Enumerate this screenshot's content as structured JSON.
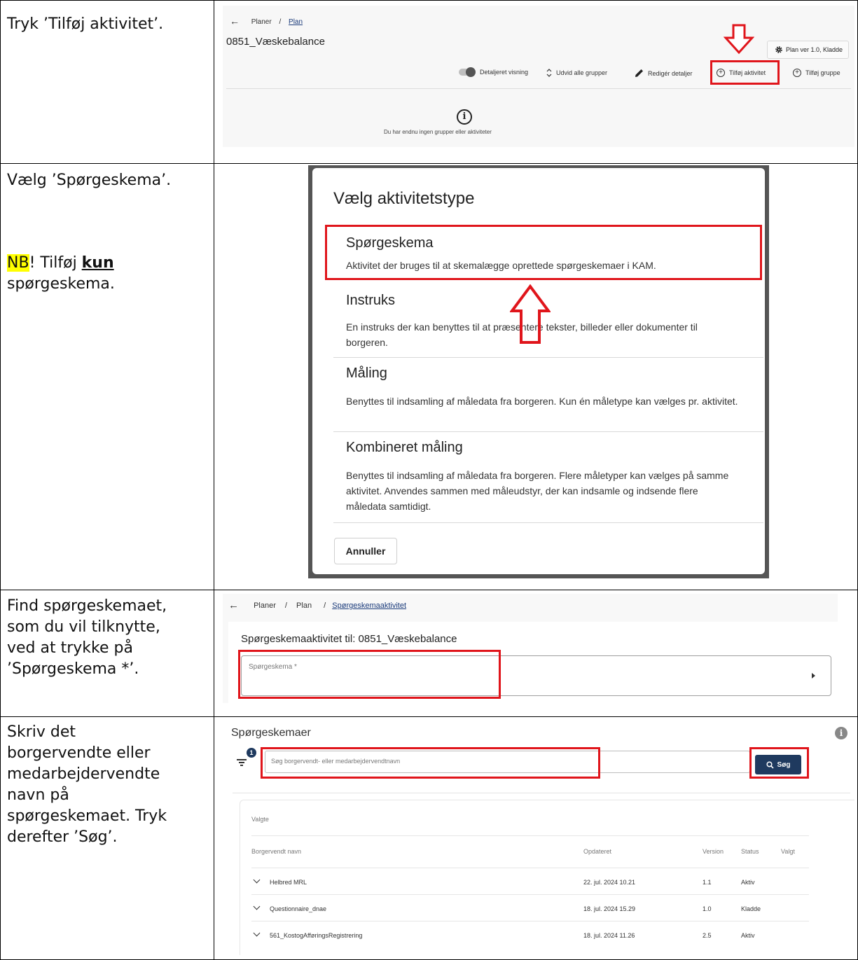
{
  "rows": [
    {
      "instruction_lines": [
        "Tryk ’Tilføj aktivitet’."
      ]
    },
    {
      "instruction_lines": [
        "Vælg ’Spørgeskema’."
      ],
      "note_prefix": "NB",
      "note_mid": "! Tilføj ",
      "note_bold": "kun",
      "note_suffix": "spørgeskema."
    },
    {
      "instruction_lines": [
        "Find spørgeskemaet,",
        "som du vil tilknytte,",
        "ved at trykke på",
        "’Spørgeskema *’."
      ]
    },
    {
      "instruction_lines": [
        "Skriv det",
        "borgervendte eller",
        "medarbejdervendte",
        "navn på",
        "spørgeskemaet. Tryk",
        "derefter ’Søg’."
      ]
    }
  ],
  "shot1": {
    "breadcrumb": {
      "back": "←",
      "item1": "Planer",
      "sep": "/",
      "item2": "Plan"
    },
    "title": "0851_Væskebalance",
    "plan_version": "Plan ver 1.0, Kladde",
    "toolbar": {
      "detail_view": "Detaljeret visning",
      "expand_groups": "Udvid alle grupper",
      "edit_details": "Redigér detaljer",
      "add_activity": "Tilføj aktivitet",
      "add_group": "Tilføj gruppe"
    },
    "empty_message": "Du har endnu ingen grupper eller aktiviteter"
  },
  "shot2": {
    "title": "Vælg aktivitetstype",
    "options": [
      {
        "name": "Spørgeskema",
        "description": "Aktivitet der bruges til at skemalægge oprettede spørgeskemaer i KAM."
      },
      {
        "name": "Instruks",
        "description": "En instruks der kan benyttes til at præsentere tekster, billeder eller dokumenter til borgeren."
      },
      {
        "name": "Måling",
        "description": "Benyttes til indsamling af måledata fra borgeren. Kun én måletype kan vælges pr. aktivitet."
      },
      {
        "name": "Kombineret måling",
        "description": "Benyttes til indsamling af måledata fra borgeren. Flere måletyper kan vælges på samme aktivitet. Anvendes sammen med måleudstyr, der kan indsamle og indsende flere måledata samtidigt."
      }
    ],
    "cancel": "Annuller"
  },
  "shot3": {
    "breadcrumb": {
      "back": "←",
      "item1": "Planer",
      "sep1": "/",
      "item2": "Plan",
      "sep2": "/",
      "item3": "Spørgeskemaaktivitet"
    },
    "title": "Spørgeskemaaktivitet til: 0851_Væskebalance",
    "field_label": "Spørgeskema *"
  },
  "shot4": {
    "title": "Spørgeskemaer",
    "info_icon": "i",
    "filter_badge": "1",
    "search_placeholder": "Søg borgervendt- eller medarbejdervendtnavn",
    "search_button": "Søg",
    "selected_label": "Valgte",
    "columns": {
      "name": "Borgervendt navn",
      "updated": "Opdateret",
      "version": "Version",
      "status": "Status",
      "selected": "Valgt"
    },
    "rows": [
      {
        "name": "Helbred MRL",
        "updated": "22. jul. 2024 10.21",
        "version": "1.1",
        "status": "Aktiv"
      },
      {
        "name": "Questionnaire_dnae",
        "updated": "18. jul. 2024 15.29",
        "version": "1.0",
        "status": "Kladde"
      },
      {
        "name": "561_KostogAfføringsRegistrering",
        "updated": "18. jul. 2024 11.26",
        "version": "2.5",
        "status": "Aktiv"
      }
    ]
  },
  "colors": {
    "highlight_red": "#e0151b",
    "note_highlight": "#ffff00",
    "primary_button": "#1f3a5f"
  },
  "icons": [
    "back-arrow-icon",
    "gear-icon",
    "toggle-icon",
    "expand-icon",
    "pencil-icon",
    "add-circle-icon",
    "info-icon",
    "filter-icon",
    "search-icon",
    "chevron-down-icon",
    "caret-right-icon",
    "down-arrow-annotation",
    "up-arrow-annotation"
  ]
}
